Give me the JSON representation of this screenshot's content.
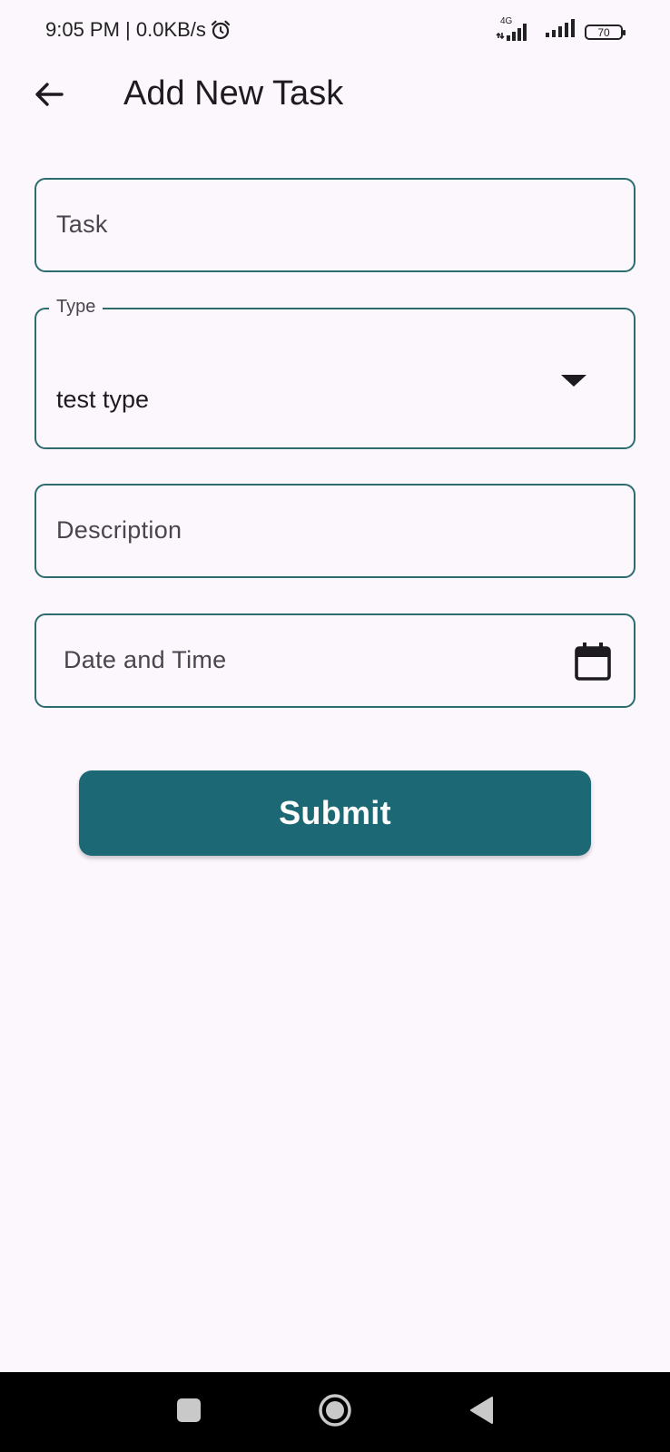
{
  "status_bar": {
    "time_speed": "9:05 PM | 0.0KB/s",
    "network_type": "4G",
    "battery_level": "70"
  },
  "app_bar": {
    "title": "Add New Task"
  },
  "form": {
    "task": {
      "placeholder": "Task",
      "value": ""
    },
    "type": {
      "label": "Type",
      "value": "test type"
    },
    "description": {
      "placeholder": "Description",
      "value": ""
    },
    "date_time": {
      "placeholder": "Date and Time",
      "value": ""
    },
    "submit_label": "Submit"
  },
  "colors": {
    "accent": "#1c6875",
    "field_border": "#2c6c70",
    "background": "#fcf7fd"
  },
  "icons": {
    "alarm": "alarm-icon",
    "signal": "signal-icon",
    "battery": "battery-icon",
    "back": "arrow-left-icon",
    "dropdown": "caret-down-icon",
    "calendar": "calendar-icon",
    "nav_recents": "square-icon",
    "nav_home": "circle-icon",
    "nav_back": "triangle-back-icon"
  }
}
